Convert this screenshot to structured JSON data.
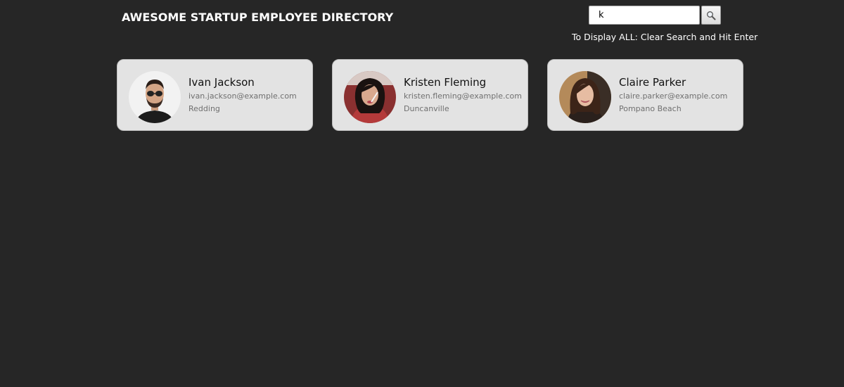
{
  "header": {
    "title": "AWESOME STARTUP EMPLOYEE DIRECTORY"
  },
  "search": {
    "value": "k",
    "placeholder": "",
    "button_icon": "magnifier-icon",
    "hint": "To Display ALL: Clear Search and Hit Enter"
  },
  "employees": [
    {
      "name": "Ivan Jackson",
      "email": "ivan.jackson@example.com",
      "city": "Redding"
    },
    {
      "name": "Kristen Fleming",
      "email": "kristen.fleming@example.com",
      "city": "Duncanville"
    },
    {
      "name": "Claire Parker",
      "email": "claire.parker@example.com",
      "city": "Pompano Beach"
    }
  ],
  "colors": {
    "background": "#262626",
    "card": "#e3e3e3",
    "title": "#ffffff",
    "secondary_text": "#707070"
  }
}
